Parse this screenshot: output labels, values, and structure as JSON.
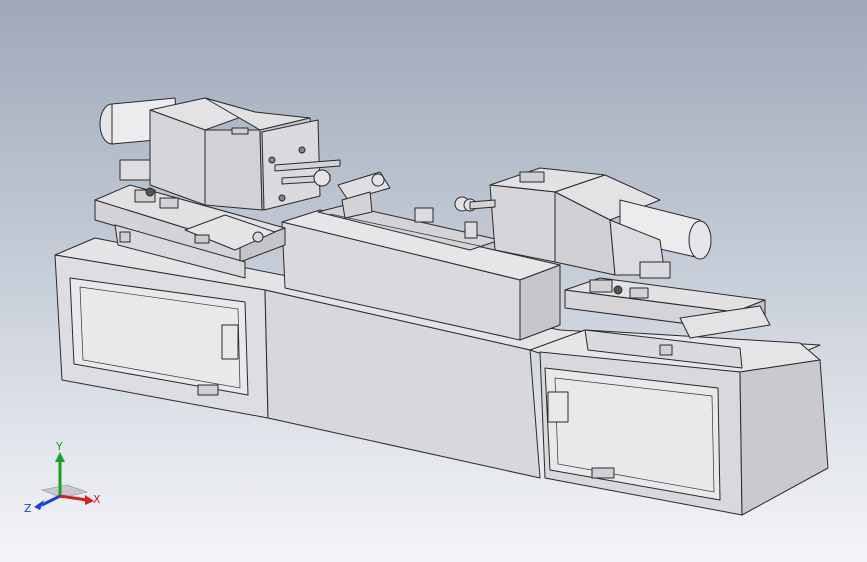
{
  "triad": {
    "x_label": "X",
    "y_label": "Y",
    "z_label": "Z"
  },
  "colors": {
    "background_top": "#9ea8b8",
    "background_bottom": "#f4f5f8",
    "part_face_light": "#e7e7e9",
    "part_face_mid": "#d6d6da",
    "part_face_dark": "#bfbfc5",
    "edge": "#2a2a2a",
    "axis_x": "#d62020",
    "axis_y": "#1aa02a",
    "axis_z": "#1f3fd6"
  }
}
